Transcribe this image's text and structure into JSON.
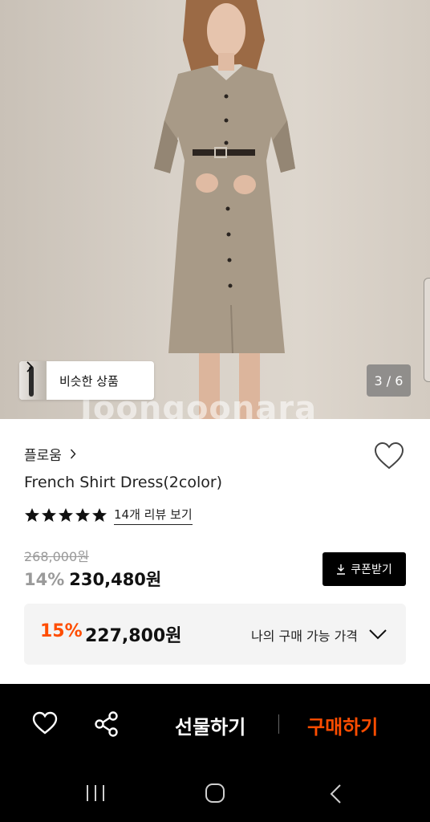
{
  "image": {
    "similar_products_label": "비슷한 상품",
    "counter": "3 / 6",
    "watermark": "Joongoonara"
  },
  "product": {
    "brand": "플로움",
    "title": "French Shirt Dress(2color)",
    "rating": 5,
    "rating_max": 5,
    "review_link": "14개 리뷰 보기",
    "original_price": "268,000원",
    "discount_percent": "14%",
    "sale_price": "230,480원",
    "coupon_button": "쿠폰받기"
  },
  "my_price": {
    "discount_percent": "15%",
    "amount": "227,800원",
    "label": "나의 구매 가능 가격"
  },
  "action_bar": {
    "gift_label": "선물하기",
    "buy_label": "구매하기"
  },
  "colors": {
    "accent": "#ff4d00",
    "bar_background": "#000000",
    "price_box": "#f4f4f4"
  },
  "icons": [
    "heart-icon",
    "share-icon",
    "chevron-right-icon",
    "chevron-down-icon",
    "download-icon",
    "star-icon",
    "recent-apps-icon",
    "home-icon",
    "back-icon"
  ]
}
